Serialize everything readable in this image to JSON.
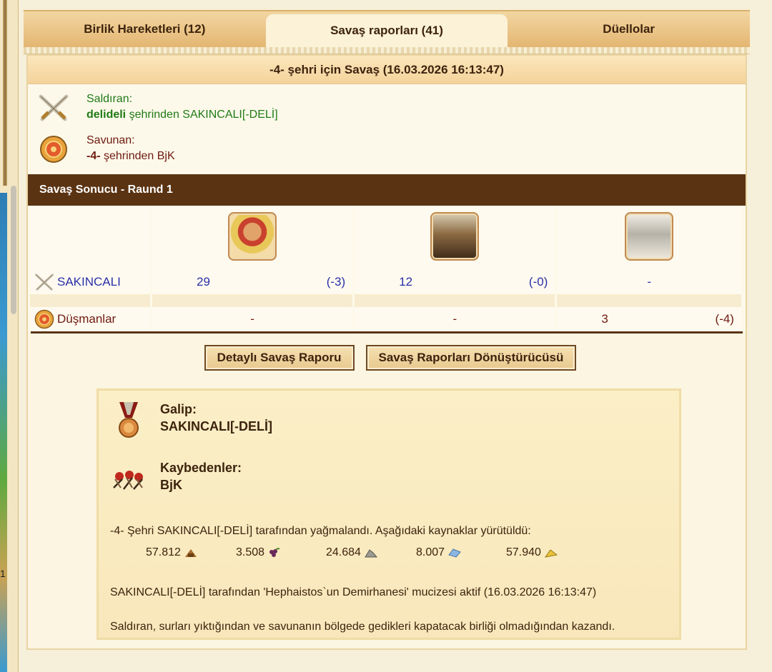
{
  "tabs": [
    {
      "label": "Birlik Hareketleri (12)",
      "active": false
    },
    {
      "label": "Savaş raporları (41)",
      "active": true
    },
    {
      "label": "Düellolar",
      "active": false
    }
  ],
  "report": {
    "title": "-4- şehri için Savaş (16.03.2026 16:13:47)",
    "attacker": {
      "label": "Saldıran:",
      "city": "delideli",
      "city_suffix": " şehrinden SAKINCALI[-DELİ]"
    },
    "defender": {
      "label": "Savunan:",
      "city": "-4-",
      "city_suffix": " şehrinden BjK"
    }
  },
  "battle_result": {
    "header": "Savaş Sonucu - Raund 1",
    "units": [
      {
        "icon": "hoplite-unit-icon"
      },
      {
        "icon": "catapult-unit-icon"
      },
      {
        "icon": "city-wall-icon"
      }
    ],
    "rows": [
      {
        "name": "SAKINCALI",
        "icon": "crossed-swords-icon",
        "values": [
          {
            "count": "29",
            "loss": "(-3)"
          },
          {
            "count": "12",
            "loss": "(-0)"
          },
          {
            "count": "-",
            "loss": ""
          }
        ]
      },
      {
        "name": "Düşmanlar",
        "icon": "shield-icon",
        "values": [
          {
            "count": "-",
            "loss": ""
          },
          {
            "count": "-",
            "loss": ""
          },
          {
            "count": "3",
            "loss": "(-4)"
          }
        ]
      }
    ]
  },
  "buttons": {
    "detailed_report": "Detaylı Savaş Raporu",
    "converter": "Savaş Raporları Dönüştürücüsü"
  },
  "summary": {
    "winner_label": "Galip:",
    "winner_name": "SAKINCALI[-DELİ]",
    "loser_label": "Kaybedenler:",
    "loser_name": "BjK",
    "loot_text": "-4- Şehri SAKINCALI[-DELİ] tarafından yağmalandı. Aşağıdaki kaynaklar yürütüldü:",
    "resources": [
      {
        "amount": "57.812",
        "icon": "wood-icon"
      },
      {
        "amount": "3.508",
        "icon": "grapes-icon"
      },
      {
        "amount": "24.684",
        "icon": "marble-icon"
      },
      {
        "amount": "8.007",
        "icon": "crystal-icon"
      },
      {
        "amount": "57.940",
        "icon": "sulphur-icon"
      }
    ],
    "wonder_text": "SAKINCALI[-DELİ] tarafından 'Hephaistos`un Demirhanesi' mucizesi aktif (16.03.2026 16:13:47)",
    "reason_text": "Saldıran, surları yıktığından ve savunanın bölgede gedikleri kapatacak birliği olmadığından kazandı."
  },
  "left_strip": {
    "marker": "1"
  },
  "colors": {
    "header_bar": "#5a3312",
    "attacker_green": "#1f7a16",
    "defender_red": "#6e1a10",
    "unit_blue": "#2a2fa8"
  }
}
